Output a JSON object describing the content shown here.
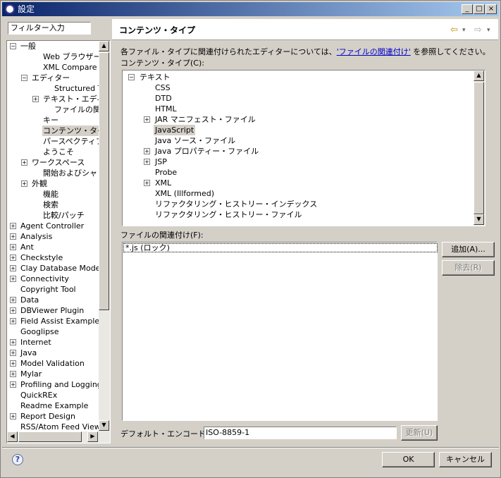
{
  "window": {
    "title": "設定",
    "buttons": [
      "_",
      "□",
      "×"
    ]
  },
  "filter": {
    "placeholder": "フィルター入力"
  },
  "tree": {
    "items": [
      {
        "label": "一般",
        "indent": 0,
        "expander": "−"
      },
      {
        "label": "Web ブラウザー",
        "indent": 2,
        "expander": ""
      },
      {
        "label": "XML Compare",
        "indent": 2,
        "expander": ""
      },
      {
        "label": "エディター",
        "indent": 1,
        "expander": "−"
      },
      {
        "label": "Structured Text Editors",
        "indent": 3,
        "expander": ""
      },
      {
        "label": "テキスト・エディター",
        "indent": 2,
        "expander": "+"
      },
      {
        "label": "ファイルの関連付け",
        "indent": 3,
        "expander": ""
      },
      {
        "label": "キー",
        "indent": 2,
        "expander": ""
      },
      {
        "label": "コンテンツ・タイプ",
        "indent": 2,
        "expander": "",
        "selected": true
      },
      {
        "label": "パースペクティブ",
        "indent": 2,
        "expander": ""
      },
      {
        "label": "ようこそ",
        "indent": 2,
        "expander": ""
      },
      {
        "label": "ワークスペース",
        "indent": 1,
        "expander": "+"
      },
      {
        "label": "開始およびシャットダウン",
        "indent": 2,
        "expander": ""
      },
      {
        "label": "外観",
        "indent": 1,
        "expander": "+"
      },
      {
        "label": "機能",
        "indent": 2,
        "expander": ""
      },
      {
        "label": "検索",
        "indent": 2,
        "expander": ""
      },
      {
        "label": "比較/パッチ",
        "indent": 2,
        "expander": ""
      },
      {
        "label": "Agent Controller",
        "indent": 0,
        "expander": "+"
      },
      {
        "label": "Analysis",
        "indent": 0,
        "expander": "+"
      },
      {
        "label": "Ant",
        "indent": 0,
        "expander": "+"
      },
      {
        "label": "Checkstyle",
        "indent": 0,
        "expander": "+"
      },
      {
        "label": "Clay Database Modeling",
        "indent": 0,
        "expander": "+"
      },
      {
        "label": "Connectivity",
        "indent": 0,
        "expander": "+"
      },
      {
        "label": "Copyright Tool",
        "indent": 0,
        "expander": ""
      },
      {
        "label": "Data",
        "indent": 0,
        "expander": "+"
      },
      {
        "label": "DBViewer Plugin",
        "indent": 0,
        "expander": "+"
      },
      {
        "label": "Field Assist Example",
        "indent": 0,
        "expander": "+"
      },
      {
        "label": "Googlipse",
        "indent": 0,
        "expander": ""
      },
      {
        "label": "Internet",
        "indent": 0,
        "expander": "+"
      },
      {
        "label": "Java",
        "indent": 0,
        "expander": "+"
      },
      {
        "label": "Model Validation",
        "indent": 0,
        "expander": "+"
      },
      {
        "label": "Mylar",
        "indent": 0,
        "expander": "+"
      },
      {
        "label": "Profiling and Logging",
        "indent": 0,
        "expander": "+"
      },
      {
        "label": "QuickREx",
        "indent": 0,
        "expander": ""
      },
      {
        "label": "Readme Example",
        "indent": 0,
        "expander": ""
      },
      {
        "label": "Report Design",
        "indent": 0,
        "expander": "+"
      },
      {
        "label": "RSS/Atom Feed View",
        "indent": 0,
        "expander": ""
      }
    ]
  },
  "page": {
    "title": "コンテンツ・タイプ",
    "nav_back": "⇦",
    "nav_forward": "⇨",
    "nav_menu": "▾",
    "description_prefix": "各ファイル・タイプに関連付けられたエディターについては、",
    "description_link": "'ファイルの関連付け'",
    "description_suffix": " を参照してください。",
    "content_types_label": "コンテンツ・タイプ(C):",
    "file_assoc_label": "ファイルの関連付け(F):",
    "encoding_label": "デフォルト・エンコード(E):",
    "encoding_value": "ISO-8859-1"
  },
  "content_types": [
    {
      "label": "テキスト",
      "indent": 0,
      "expander": "−"
    },
    {
      "label": "CSS",
      "indent": 1,
      "expander": ""
    },
    {
      "label": "DTD",
      "indent": 1,
      "expander": ""
    },
    {
      "label": "HTML",
      "indent": 1,
      "expander": ""
    },
    {
      "label": "JAR マニフェスト・ファイル",
      "indent": 1,
      "expander": "+"
    },
    {
      "label": "JavaScript",
      "indent": 1,
      "expander": "",
      "selected": true
    },
    {
      "label": "Java ソース・ファイル",
      "indent": 1,
      "expander": ""
    },
    {
      "label": "Java プロパティー・ファイル",
      "indent": 1,
      "expander": "+"
    },
    {
      "label": "JSP",
      "indent": 1,
      "expander": "+"
    },
    {
      "label": "Probe",
      "indent": 1,
      "expander": ""
    },
    {
      "label": "XML",
      "indent": 1,
      "expander": "+"
    },
    {
      "label": "XML (Illformed)",
      "indent": 1,
      "expander": ""
    },
    {
      "label": "リファクタリング・ヒストリー・インデックス",
      "indent": 1,
      "expander": ""
    },
    {
      "label": "リファクタリング・ヒストリー・ファイル",
      "indent": 1,
      "expander": ""
    }
  ],
  "file_associations": [
    "*.js (ロック)"
  ],
  "buttons": {
    "add": "追加(A)...",
    "remove": "除去(R)",
    "update": "更新(U)",
    "ok": "OK",
    "cancel": "キャンセル",
    "help": "?"
  },
  "colors": {
    "title_start": "#0a246a",
    "title_end": "#a6caf0",
    "link": "#0000cc",
    "face": "#d4d0c8"
  }
}
